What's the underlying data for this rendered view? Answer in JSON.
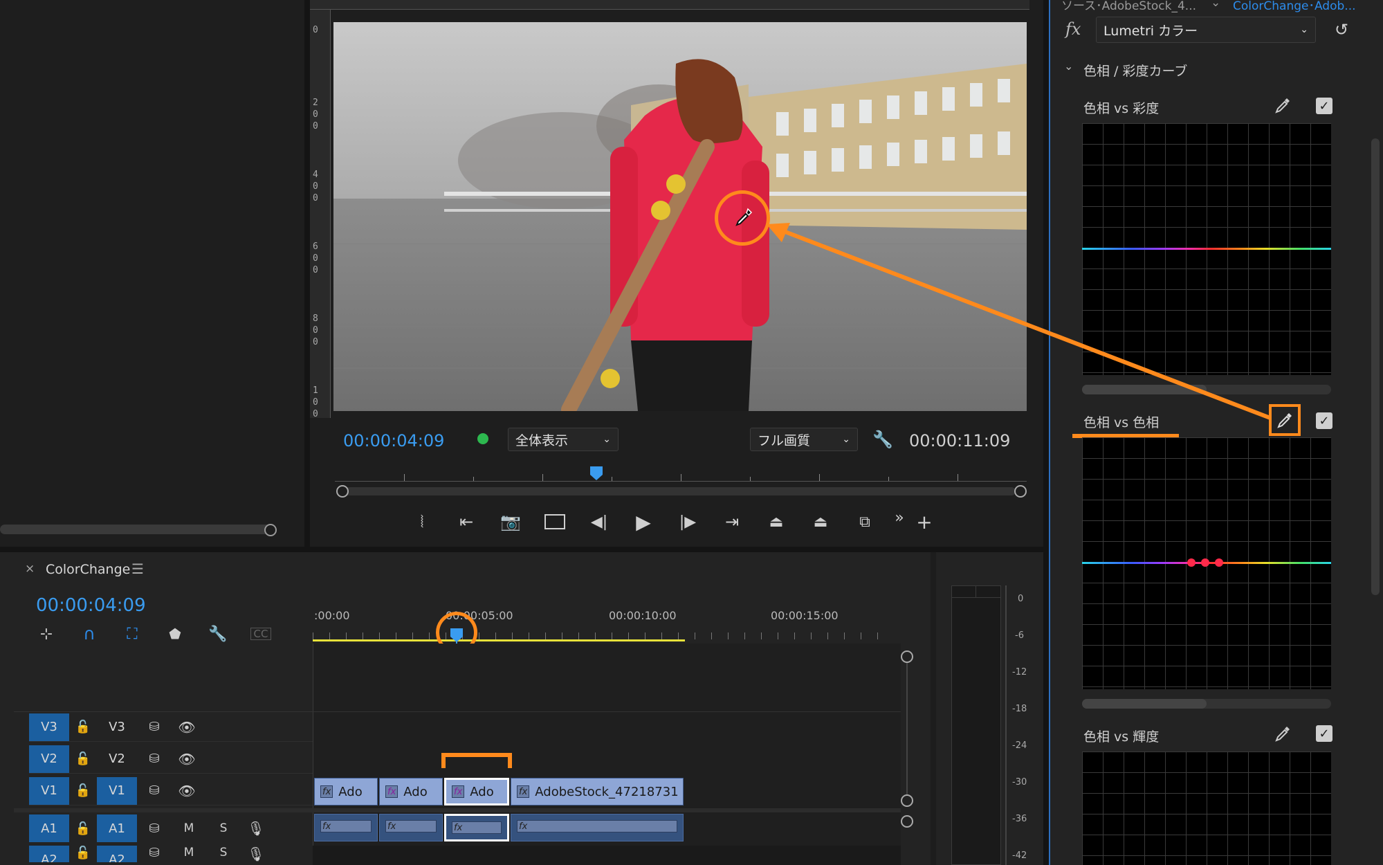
{
  "colors": {
    "accent_blue": "#2d8ceb",
    "annotation_orange": "#ff8a1c",
    "clip_video": "#8ea6d6",
    "clip_audio": "#35527e",
    "graph_bg": "#000000"
  },
  "effects_header": {
    "source_tab": "ソース･AdobeStock_4...",
    "sequence_tab": "ColorChange･Adob..."
  },
  "effect_controls": {
    "fx_label": "fx",
    "effect_select": "Lumetri カラー",
    "section_title": "色相 / 彩度カーブ",
    "curves": [
      {
        "label": "色相 vs 彩度"
      },
      {
        "label": "色相 vs 色相"
      },
      {
        "label": "色相 vs 輝度"
      }
    ]
  },
  "program_monitor": {
    "current_time": "00:00:04:09",
    "zoom_select": "全体表示",
    "quality_select": "フル画質",
    "duration": "00:00:11:09",
    "playhead_fraction": 0.37,
    "ruler_labels": [
      "0",
      "2\n0\n0",
      "4\n0\n0",
      "6\n0\n0",
      "8\n0\n0",
      "1\n0\n0"
    ]
  },
  "timeline": {
    "sequence_name": "ColorChange",
    "current_time": "00:00:04:09",
    "time_labels": [
      ":00:00",
      "00:00:05:00",
      "00:00:10:00",
      "00:00:15:00"
    ],
    "tracks": [
      {
        "id": "V3",
        "target": "V3",
        "toggle": "",
        "solo": "",
        "selected": false
      },
      {
        "id": "V2",
        "target": "V2",
        "toggle": "",
        "solo": "",
        "selected": false
      },
      {
        "id": "V1",
        "target": "V1",
        "toggle": "",
        "solo": "",
        "selected": true
      },
      {
        "id": "A1",
        "target": "A1",
        "toggle": "M",
        "solo": "S",
        "selected": true
      },
      {
        "id": "A2",
        "target": "A2",
        "toggle": "M",
        "solo": "S",
        "selected": true
      }
    ],
    "clips": [
      {
        "label": "Ado"
      },
      {
        "label": "Ado"
      },
      {
        "label": "Ado"
      },
      {
        "label": "AdobeStock_47218731"
      }
    ]
  },
  "audio_meter": {
    "labels": [
      "0",
      "-6",
      "-12",
      "-18",
      "-24",
      "-30",
      "-36",
      "-42"
    ]
  }
}
